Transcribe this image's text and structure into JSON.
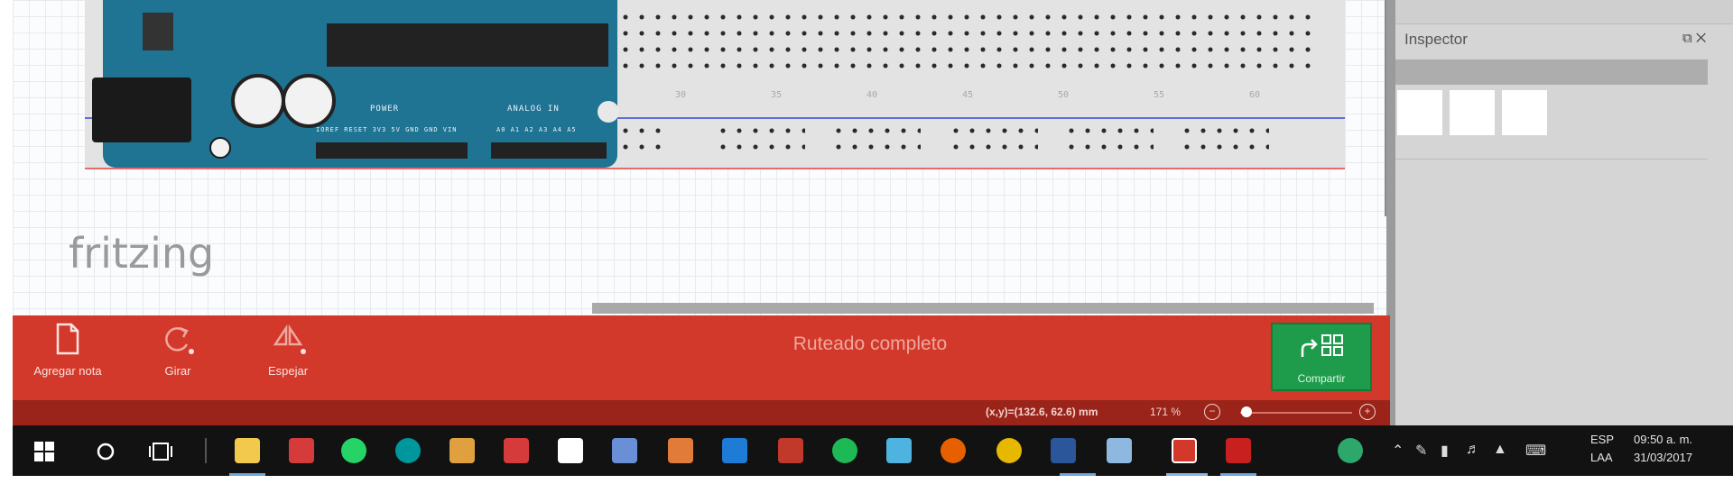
{
  "canvas": {
    "logo_text": "fritzing",
    "breadboard_col_labels": [
      "30",
      "35",
      "40",
      "45",
      "50",
      "55",
      "60"
    ],
    "arduino_labels": {
      "power": "POWER",
      "analog": "ANALOG IN",
      "power_pins": "IOREF RESET 3V3 5V GND GND VIN",
      "analog_pins": "A0 A1 A2 A3 A4 A5"
    }
  },
  "inspector": {
    "title": "Inspector",
    "controls": "⧉ ✕"
  },
  "toolbar": {
    "add_note_label": "Agregar nota",
    "rotate_label": "Girar",
    "flip_label": "Espejar",
    "route_status": "Ruteado completo",
    "share_label": "Compartir"
  },
  "statusbar": {
    "coords": "(x,y)=(132.6, 62.6) mm",
    "zoom": "171 %",
    "zoom_level": 0.06
  },
  "taskbar": {
    "start_icon": "windows-start-icon",
    "apps": [
      {
        "name": "file-explorer-icon",
        "color": "#f2c94c"
      },
      {
        "name": "mail-icon",
        "color": "#d63b3b"
      },
      {
        "name": "whatsapp-icon",
        "color": "#25d366"
      },
      {
        "name": "arduino-icon",
        "color": "#00979c"
      },
      {
        "name": "scratch-icon",
        "color": "#e0a040"
      },
      {
        "name": "red-app-icon",
        "color": "#d63b3b"
      },
      {
        "name": "store-icon",
        "color": "#ffffff"
      },
      {
        "name": "app-icon-blue",
        "color": "#6b8fd6"
      },
      {
        "name": "app-icon-orange",
        "color": "#e07b39"
      },
      {
        "name": "edge-icon",
        "color": "#1e7bd6"
      },
      {
        "name": "app-icon-red",
        "color": "#c0392b"
      },
      {
        "name": "spotify-icon",
        "color": "#1db954"
      },
      {
        "name": "app-icon-cyan",
        "color": "#4fb3e0"
      },
      {
        "name": "firefox-icon",
        "color": "#e66000"
      },
      {
        "name": "chrome-icon",
        "color": "#e6b800"
      },
      {
        "name": "word-icon",
        "color": "#2b579a"
      },
      {
        "name": "app-icon-lightblue",
        "color": "#8fb8e0"
      },
      {
        "name": "fritzing-icon",
        "color": "#d2392a"
      },
      {
        "name": "acrobat-icon",
        "color": "#c8201e"
      },
      {
        "name": "activity-monitor-icon",
        "color": "#2ea86a"
      }
    ],
    "language": [
      "ESP",
      "LAA"
    ],
    "time": "09:50 a. m.",
    "date": "31/03/2017"
  },
  "colors": {
    "toolbar_red": "#d2392a",
    "statusbar_red": "#9a2419",
    "share_green": "#1e9c4b",
    "arduino_blue": "#1f7393"
  }
}
